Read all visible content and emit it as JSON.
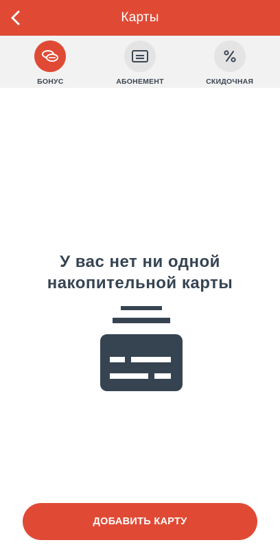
{
  "header": {
    "title": "Карты",
    "back_icon": "chevron-left-icon"
  },
  "tabs": [
    {
      "label": "БОНУС",
      "icon": "coins-icon",
      "active": true
    },
    {
      "label": "АБОНЕМЕНТ",
      "icon": "card-icon",
      "active": false
    },
    {
      "label": "СКИДОЧНАЯ",
      "icon": "percent-icon",
      "active": false
    }
  ],
  "empty_state": {
    "line1": "У вас нет ни одной",
    "line2": "накопительной карты",
    "icon": "empty-cards-icon"
  },
  "add_button": {
    "label": "ДОБАВИТЬ КАРТУ"
  },
  "colors": {
    "accent": "#e04a35",
    "tab_bar": "#f2f2f2",
    "tab_inactive": "#e4e4e4",
    "text_dark": "#364452"
  }
}
